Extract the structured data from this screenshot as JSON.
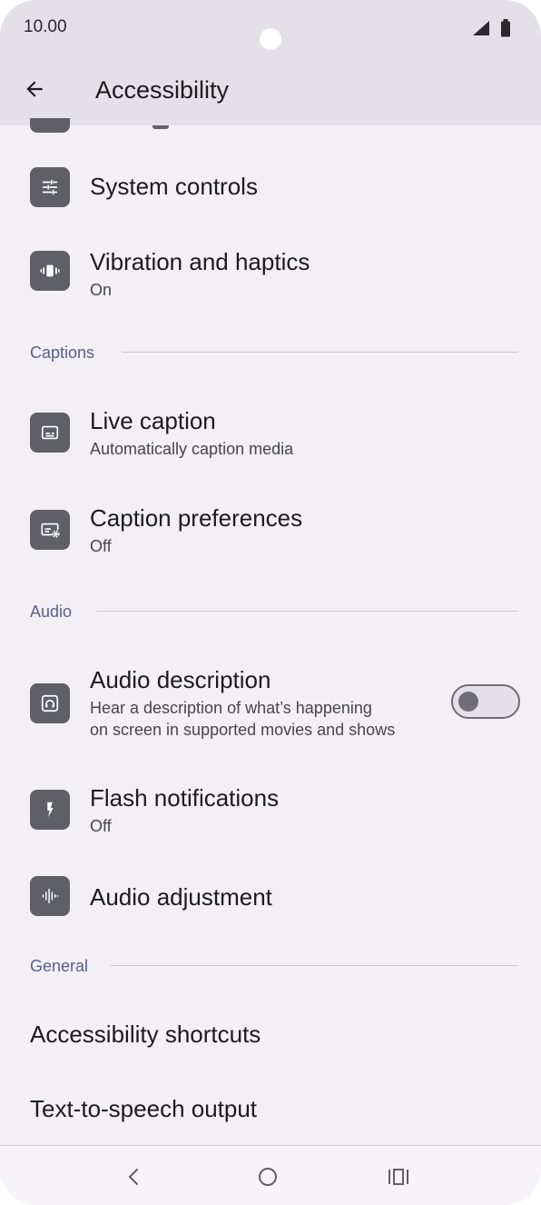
{
  "status_bar": {
    "time": "10.00",
    "signal_icon": "signal-icon",
    "battery_icon": "battery-icon"
  },
  "app_bar": {
    "back_icon": "arrow-back-icon",
    "title": "Accessibility"
  },
  "items": [
    {
      "id": "system-controls",
      "title": "System controls",
      "icon": "tune-icon"
    },
    {
      "id": "vibration-haptics",
      "title": "Vibration and haptics",
      "subtitle": "On",
      "icon": "vibration-icon"
    }
  ],
  "sections": {
    "captions": {
      "label": "Captions",
      "items": [
        {
          "id": "live-caption",
          "title": "Live caption",
          "subtitle": "Automatically caption media",
          "icon": "subtitles-icon"
        },
        {
          "id": "caption-preferences",
          "title": "Caption preferences",
          "subtitle": "Off",
          "icon": "caption-settings-icon"
        }
      ]
    },
    "audio": {
      "label": "Audio",
      "items": [
        {
          "id": "audio-description",
          "title": "Audio description",
          "subtitle_line1": "Hear a description of what’s happening",
          "subtitle_line2": "on screen in supported movies and shows",
          "icon": "headphones-icon",
          "toggle_on": false
        },
        {
          "id": "flash-notifications",
          "title": "Flash notifications",
          "subtitle": "Off",
          "icon": "flash-icon"
        },
        {
          "id": "audio-adjustment",
          "title": "Audio adjustment",
          "icon": "waveform-icon"
        }
      ]
    },
    "general": {
      "label": "General",
      "items": [
        {
          "id": "accessibility-shortcuts",
          "title": "Accessibility shortcuts"
        },
        {
          "id": "text-to-speech",
          "title": "Text-to-speech output"
        }
      ]
    }
  },
  "nav_bar": {
    "back": "nav-back-icon",
    "home": "nav-home-icon",
    "recents": "nav-recents-icon"
  },
  "colors": {
    "background": "#f2eff5",
    "app_bar": "#e3e1e7",
    "icon_tile": "#5f6066",
    "section_label": "#5b5e8a"
  }
}
